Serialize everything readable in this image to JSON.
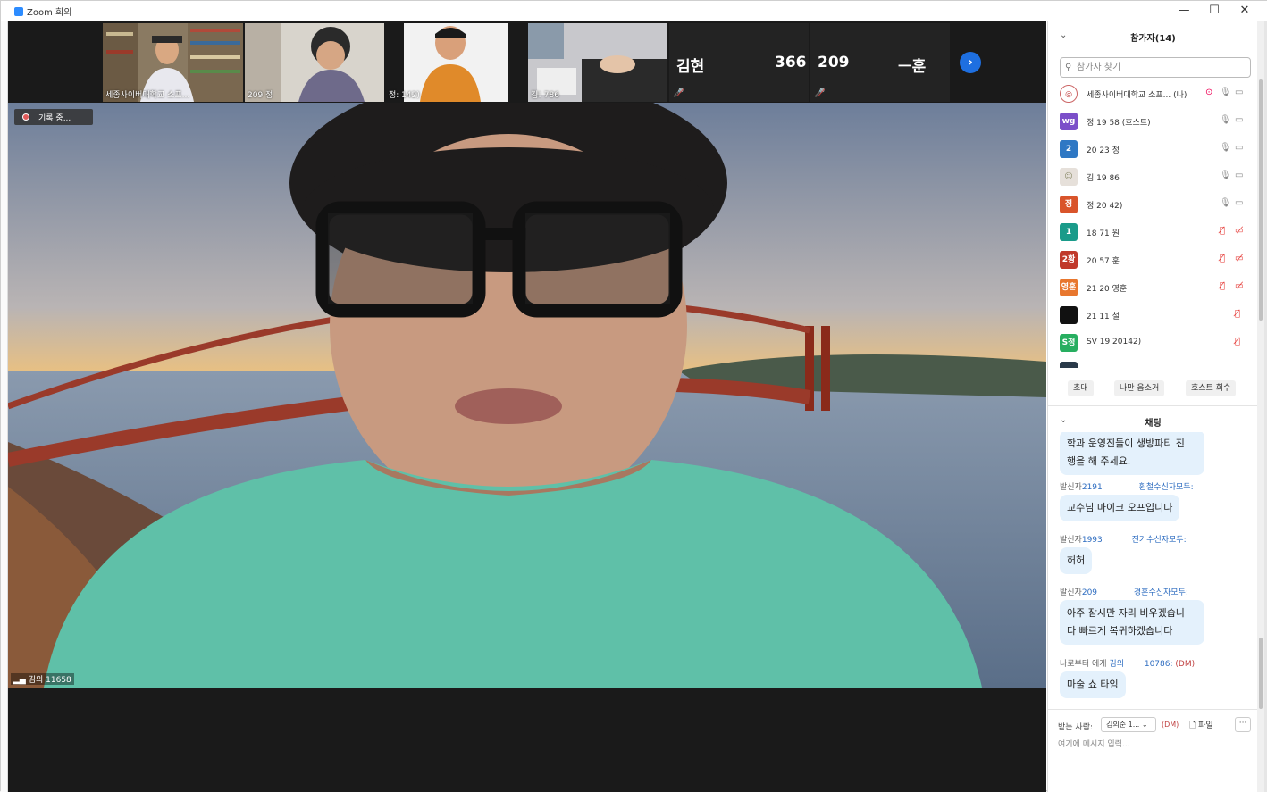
{
  "window": {
    "title": "Zoom 회의",
    "minimize": "—",
    "maximize": "☐",
    "close": "✕"
  },
  "thumbnails": [
    {
      "label": "세종사이버대학교 소프..."
    },
    {
      "label": "209        정"
    },
    {
      "label": "정:         142)"
    },
    {
      "label": "김!                786"
    }
  ],
  "name_tiles": [
    {
      "name": "김현"
    },
    {
      "name": "366"
    },
    {
      "name": "209"
    },
    {
      "name": "ㅡ훈"
    }
  ],
  "main_video": {
    "recording_label": "기록 중...",
    "speaker_name": "김의           11658"
  },
  "participants": {
    "title": "참가자(14)",
    "search_placeholder": "참가자 찾기",
    "rows": [
      {
        "avatar": "",
        "color": "#ffffff",
        "name": "세종사이버대학교 소프... (나)",
        "muted": false,
        "video_off": false
      },
      {
        "avatar": "wg",
        "color": "#7b4fc9",
        "name": "정      19      58 (호스트)",
        "muted": false,
        "video_off": false
      },
      {
        "avatar": "2",
        "color": "#2f78c4",
        "name": "20      23      정",
        "muted": false,
        "video_off": false
      },
      {
        "avatar": "",
        "color": "#cccccc",
        "name": "김      19      86",
        "muted": false,
        "video_off": false
      },
      {
        "avatar": "정",
        "color": "#d9542b",
        "name": "정      20      42)",
        "muted": false,
        "video_off": false
      },
      {
        "avatar": "1",
        "color": "#1a9b8a",
        "name": "18      71      원",
        "muted": true,
        "video_off": true
      },
      {
        "avatar": "2황",
        "color": "#c0392b",
        "name": "20      57      훈",
        "muted": true,
        "video_off": true
      },
      {
        "avatar": "영훈",
        "color": "#e8772e",
        "name": "21      20      영훈",
        "muted": true,
        "video_off": true
      },
      {
        "avatar": "",
        "color": "#111111",
        "name": "21      11      철",
        "muted": true,
        "video_off": false
      },
      {
        "avatar": "S정",
        "color": "#27ae60",
        "name": "SV      19      20142)",
        "muted": true,
        "video_off": false
      }
    ],
    "buttons": {
      "invite": "초대",
      "mute_self": "나만 음소거",
      "host_claim": "호스트 회수"
    }
  },
  "chat": {
    "title": "채팅",
    "messages": [
      {
        "text_lines": [
          "학과 운영진들이 생방파티 진",
          "행을 해 주세요."
        ]
      },
      {
        "meta_prefix": "발신자",
        "from": "2191",
        "to_label": "훤철수신자모두:",
        "text_lines": [
          "교수님 마이크 오프입니다"
        ]
      },
      {
        "meta_prefix": "발신자",
        "from": "1993",
        "to_label": "진기수신자모두:",
        "text_lines": [
          "허허"
        ]
      },
      {
        "meta_prefix": "발신자",
        "from": "209",
        "to_label": "경훈수신자모두:",
        "text_lines": [
          "아주 잠시만 자리 비우겠습니",
          "다 빠르게 복귀하겠습니다"
        ]
      },
      {
        "meta_prefix": "나로부터 에게",
        "from": "김의",
        "to_label": "10786:",
        "dm": "(DM)",
        "text_lines": [
          "마술 쇼 타임"
        ]
      }
    ],
    "composer": {
      "to_label": "받는 사람:",
      "to_value": "김의준 1...",
      "dm": "(DM)",
      "file_label": "파일",
      "more": "···",
      "placeholder": "여기에 메시지 입력..."
    }
  }
}
